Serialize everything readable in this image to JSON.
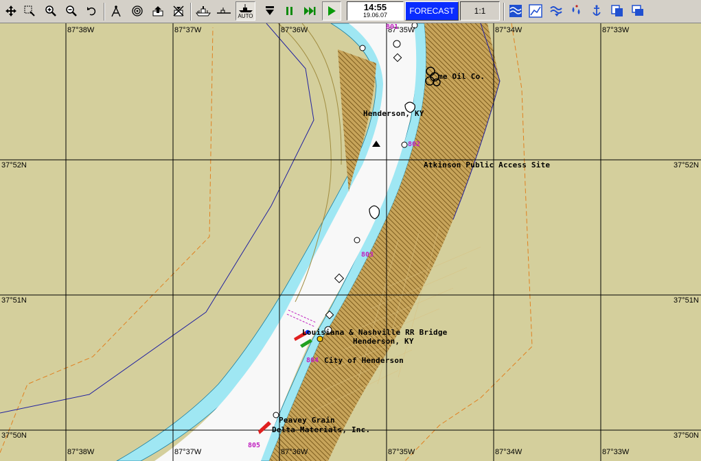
{
  "toolbar": {
    "buttons": [
      {
        "icon": "pan-arrows-icon"
      },
      {
        "icon": "zoom-select-icon"
      },
      {
        "icon": "zoom-in-icon"
      },
      {
        "icon": "zoom-out-icon"
      },
      {
        "icon": "undo-icon"
      },
      {
        "icon": "compass-divider-icon"
      },
      {
        "icon": "target-icon"
      },
      {
        "icon": "export-icon"
      },
      {
        "icon": "route-tool-icon"
      },
      {
        "icon": "ship-view-icon"
      },
      {
        "icon": "ship-side-icon"
      },
      {
        "icon": "ship-auto-icon",
        "label": "AUTO"
      },
      {
        "icon": "step-down-icon"
      },
      {
        "icon": "pause-icon"
      },
      {
        "icon": "fast-forward-icon"
      },
      {
        "icon": "play-icon"
      },
      {
        "icon": "tide-icon"
      },
      {
        "icon": "graph-icon"
      },
      {
        "icon": "current-icon"
      },
      {
        "icon": "drops-icon"
      },
      {
        "icon": "anchor-icon"
      },
      {
        "icon": "copy-icon"
      },
      {
        "icon": "windows-icon"
      }
    ],
    "clock": {
      "time": "14:55",
      "date": "19.06.07"
    },
    "forecast_label": "FORECAST",
    "scale_label": "1:1"
  },
  "map": {
    "colors": {
      "land": "#d4cf9c",
      "water": "#f8f8f8",
      "shallow": "#9fe7f3",
      "built": "#b38c3c",
      "grid": "#000000",
      "mile": "#c020c0"
    },
    "lon_labels": [
      "87°38W",
      "87°37W",
      "87°36W",
      "87°35W",
      "87°34W",
      "87°33W"
    ],
    "lat_labels": [
      "37°52N",
      "37°51N",
      "37°50N"
    ],
    "labels": {
      "oil": "me Oil Co.",
      "henderson_ky": "Henderson, KY",
      "atkinson": "Atkinson Public Access Site",
      "bridge_line1": "Louisiana & Nashville RR Bridge",
      "bridge_line2": "Henderson, KY",
      "city": "City of Henderson",
      "grain": "Peavey Grain",
      "delta": "Delta Materials, Inc."
    },
    "miles": {
      "m801": "801",
      "m802": "802",
      "m803": "803",
      "m804": "804",
      "m805": "805"
    }
  }
}
